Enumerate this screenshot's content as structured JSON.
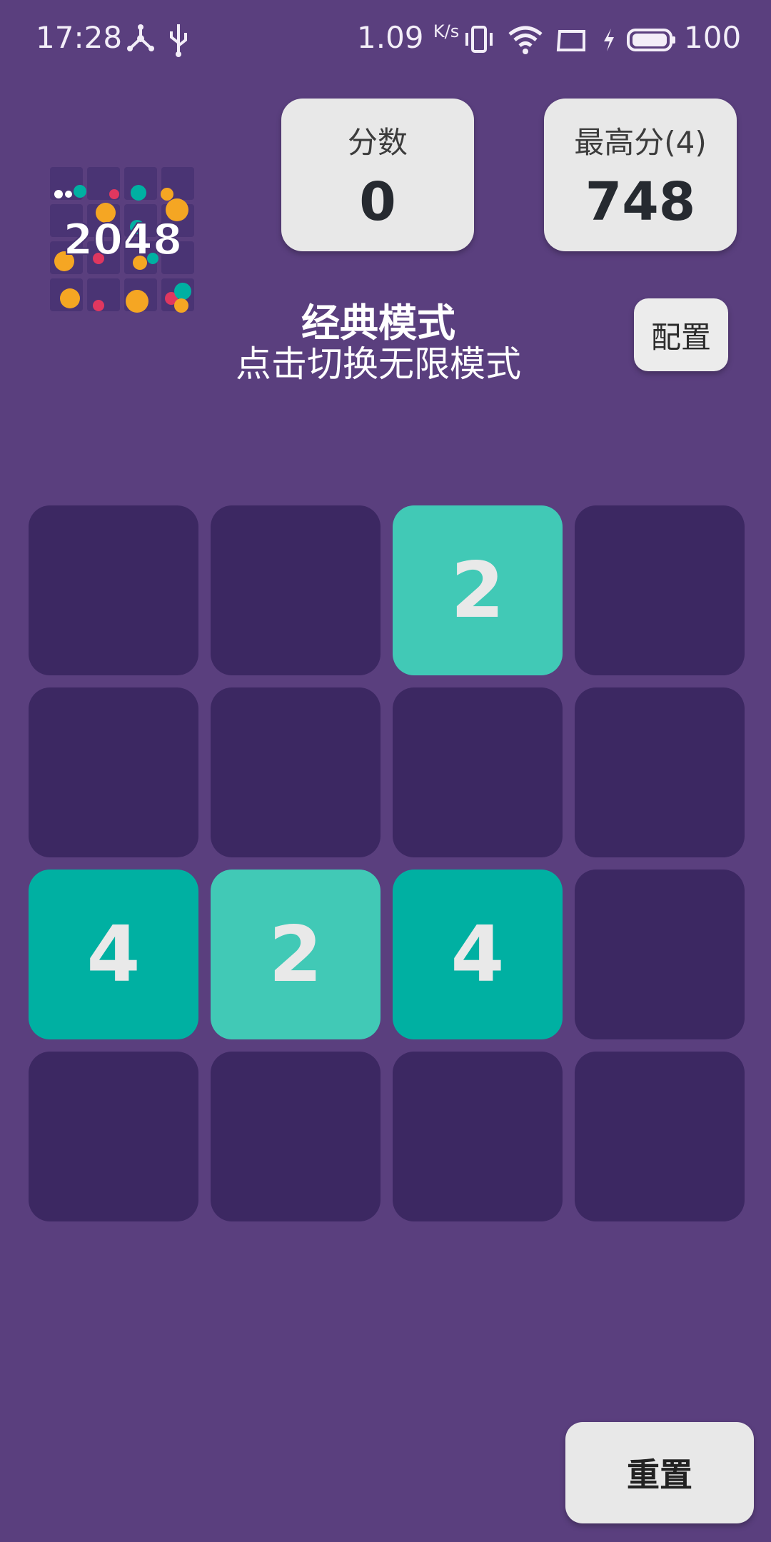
{
  "status_bar": {
    "time": "17:28",
    "net_rate": "1.09",
    "net_rate_unit": "K/s",
    "battery": "100",
    "icons": [
      "network-node-icon",
      "usb-icon",
      "vibrate-icon",
      "wifi-icon",
      "screen-icon",
      "charging-icon",
      "battery-icon"
    ]
  },
  "header": {
    "logo_text": "2048",
    "score": {
      "label": "分数",
      "value": "0"
    },
    "best": {
      "label": "最高分(4)",
      "value": "748"
    },
    "mode_title": "经典模式",
    "mode_subtitle": "点击切换无限模式",
    "config_label": "配置"
  },
  "board": {
    "rows": [
      [
        "",
        "",
        "2",
        ""
      ],
      [
        "",
        "",
        "",
        ""
      ],
      [
        "4",
        "2",
        "4",
        ""
      ],
      [
        "",
        "",
        "",
        ""
      ]
    ],
    "colors": {
      "empty": "#3c2862",
      "2": "#41c9b6",
      "4": "#00b0a2"
    }
  },
  "footer": {
    "reset_label": "重置"
  },
  "theme": {
    "background": "#5a3f7e"
  }
}
